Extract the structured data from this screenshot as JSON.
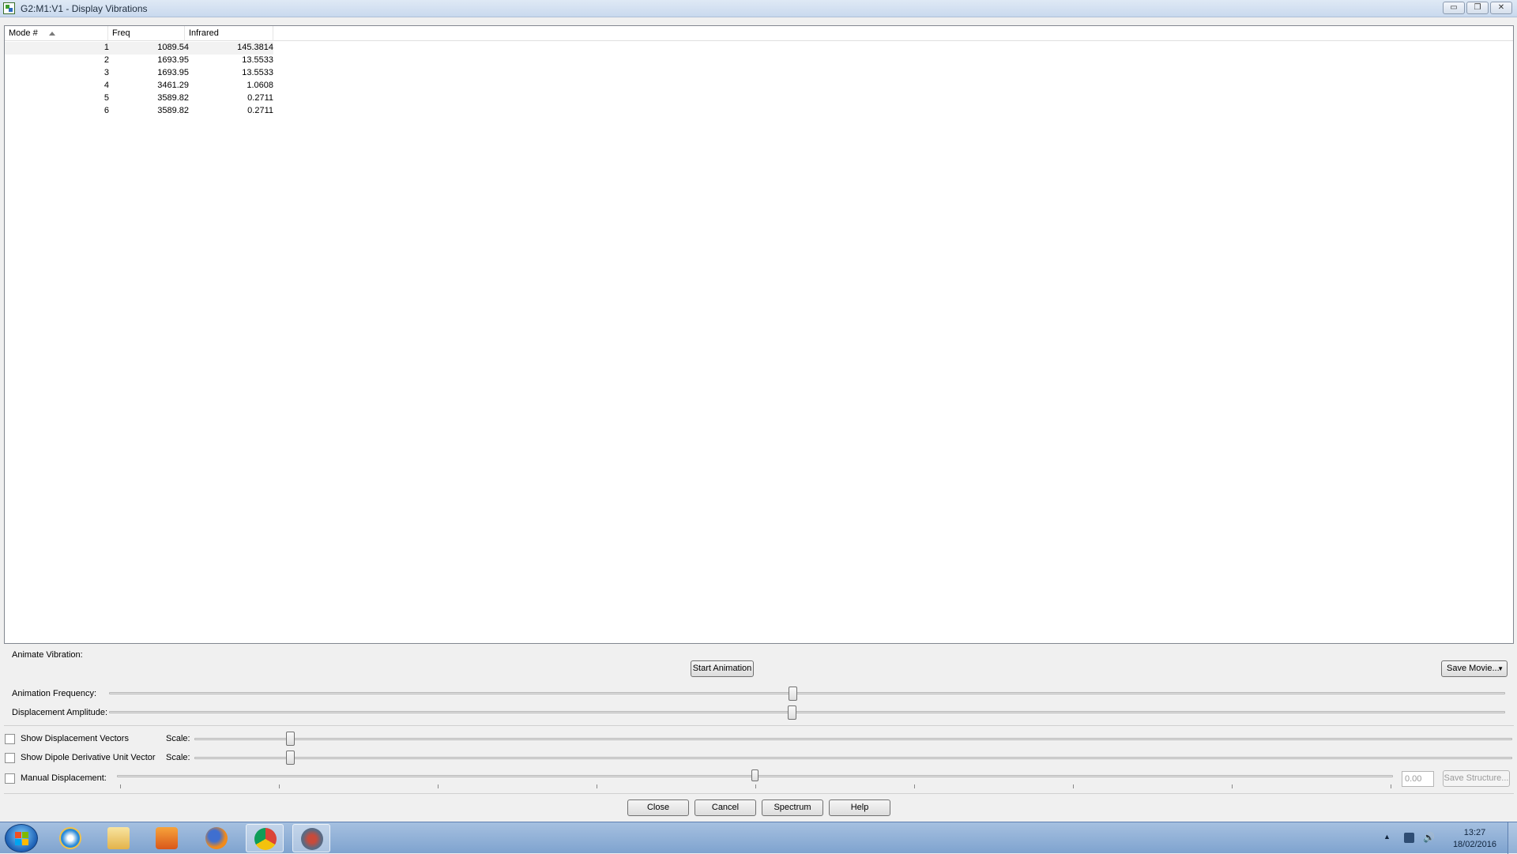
{
  "window": {
    "title": "G2:M1:V1 - Display Vibrations",
    "minimize": "▭",
    "restore": "❐",
    "close": "✕"
  },
  "table": {
    "columns": [
      "Mode #",
      "Freq",
      "Infrared"
    ],
    "rows": [
      {
        "mode": "1",
        "freq": "1089.54",
        "ir": "145.3814"
      },
      {
        "mode": "2",
        "freq": "1693.95",
        "ir": "13.5533"
      },
      {
        "mode": "3",
        "freq": "1693.95",
        "ir": "13.5533"
      },
      {
        "mode": "4",
        "freq": "3461.29",
        "ir": "1.0608"
      },
      {
        "mode": "5",
        "freq": "3589.82",
        "ir": "0.2711"
      },
      {
        "mode": "6",
        "freq": "3589.82",
        "ir": "0.2711"
      }
    ]
  },
  "animate": {
    "section_label": "Animate Vibration:",
    "start_button": "Start Animation",
    "save_movie": "Save Movie...",
    "frequency_label": "Animation Frequency:",
    "frequency_level": 0.49,
    "amplitude_label": "Displacement Amplitude:",
    "amplitude_level": 0.489
  },
  "options": {
    "show_vectors": {
      "label": "Show Displacement Vectors",
      "checked": false,
      "scale_label": "Scale:",
      "scale_level": 0.073
    },
    "show_dipole": {
      "label": "Show Dipole Derivative Unit Vector",
      "checked": false,
      "scale_label": "Scale:",
      "scale_level": 0.073
    },
    "manual": {
      "label": "Manual Displacement:",
      "checked": false,
      "level": 0.5,
      "value": "0.00",
      "save_structure": "Save Structure..."
    }
  },
  "footer": {
    "close": "Close",
    "cancel": "Cancel",
    "spectrum": "Spectrum",
    "help": "Help"
  },
  "taskbar": {
    "time": "13:27",
    "date": "18/02/2016",
    "apps": [
      "internet-explorer-icon",
      "file-explorer-icon",
      "media-player-icon",
      "firefox-icon",
      "chrome-icon",
      "gaussview-icon"
    ]
  }
}
